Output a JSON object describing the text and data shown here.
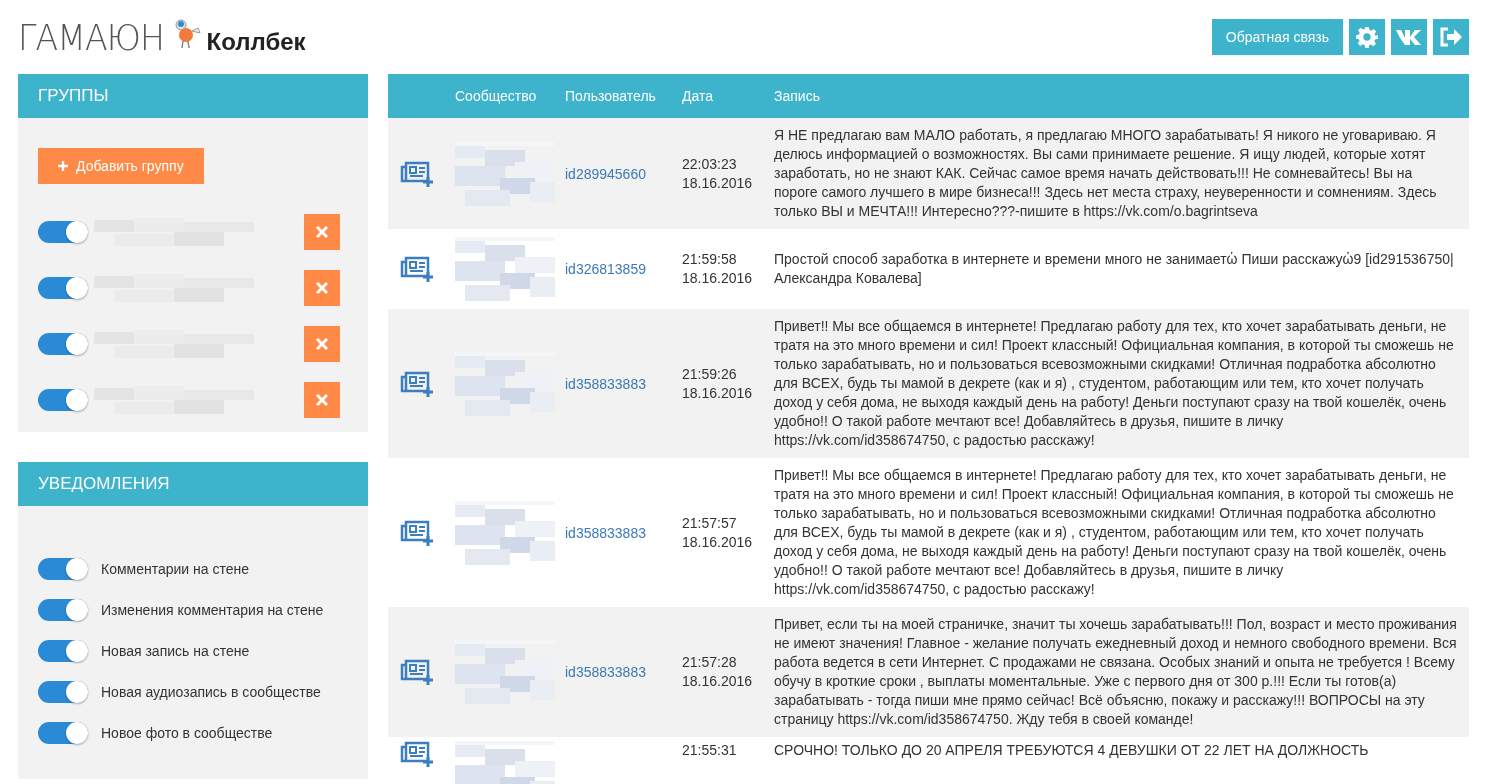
{
  "header": {
    "logo": "ГАМАЮН",
    "subtitle": "Коллбек",
    "feedback_button": "Обратная связь"
  },
  "groups_panel": {
    "title": "ГРУППЫ",
    "add_button": "Добавить группу",
    "groups": [
      {
        "on": true,
        "kind": "picture"
      },
      {
        "on": true,
        "kind": "picture"
      },
      {
        "on": true,
        "kind": "picture"
      },
      {
        "on": true,
        "kind": "picture"
      }
    ]
  },
  "notifications_panel": {
    "title": "УВЕДОМЛЕНИЯ",
    "items": [
      {
        "label": "Комментарии на стене",
        "on": true
      },
      {
        "label": "Изменения комментария на стене",
        "on": true
      },
      {
        "label": "Новая запись на стене",
        "on": true
      },
      {
        "label": "Новая аудиозапись в сообществе",
        "on": true
      },
      {
        "label": "Новое фото в сообществе",
        "on": true
      }
    ]
  },
  "table": {
    "columns": [
      "Сообщество",
      "Пользователь",
      "Дата",
      "Запись"
    ],
    "rows": [
      {
        "user": "id289945660",
        "time": "22:03:23",
        "date": "18.16.2016",
        "text": "Я НЕ предлагаю вам МАЛО работать, я предлагаю МНОГО зарабатывать! Я никого не уговариваю. Я делюсь информацией о возможностях. Вы сами принимаете решение. Я ищу людей, которые хотят заработать, но не знают КАК. Сейчас самое время начать действовать!!! Не сомневайтесь! Вы на пороге самого лучшего в мире бизнеса!!! Здесь нет места страху, неуверенности и сомнениям. Здесь только ВЫ и МЕЧТА!!! Интересно???-пишите в https://vk.com/o.bagrintseva"
      },
      {
        "user": "id326813859",
        "time": "21:59:58",
        "date": "18.16.2016",
        "text": "Простой способ заработка в интернете и времени много не занимаетὡ Пиши расскажуὠ9 [id291536750|Александра Ковалева]"
      },
      {
        "user": "id358833883",
        "time": "21:59:26",
        "date": "18.16.2016",
        "text": "Привет!! Мы все общаемся в интернете! Предлагаю работу для тех, кто хочет зарабатывать деньги, не тратя на это много времени и сил! Проект классный! Официальная компания, в которой ты сможешь не только зарабатывать, но и пользоваться всевозможными скидками! Отличная подработка абсолютно для ВСЕХ, будь ты мамой в декрете (как и я) , студентом, работающим или тем, кто хочет получать доход у себя дома, не выходя каждый день на работу! Деньги поступают сразу на твой кошелёк, очень удобно!! О такой работе мечтают все! Добавляйтесь в друзья, пишите в личку https://vk.com/id358674750, с радостью расскажу!"
      },
      {
        "user": "id358833883",
        "time": "21:57:57",
        "date": "18.16.2016",
        "text": "Привет!! Мы все общаемся в интернете! Предлагаю работу для тех, кто хочет зарабатывать деньги, не тратя на это много времени и сил! Проект классный! Официальная компания, в которой ты сможешь не только зарабатывать, но и пользоваться всевозможными скидками! Отличная подработка абсолютно для ВСЕХ, будь ты мамой в декрете (как и я) , студентом, работающим или тем, кто хочет получать доход у себя дома, не выходя каждый день на работу! Деньги поступают сразу на твой кошелёк, очень удобно!! О такой работе мечтают все! Добавляйтесь в друзья, пишите в личку https://vk.com/id358674750, с радостью расскажу!"
      },
      {
        "user": "id358833883",
        "time": "21:57:28",
        "date": "18.16.2016",
        "text": "Привет, если ты на моей страничке, значит ты хочешь зарабатывать!!! Пол, возраст и место проживания не имеют значения! Главное - желание получать ежедневный доход и немного свободного времени. Вся работа ведется в сети Интернет. С продажами не связана. Особых знаний и опыта не требуется ! Всему обучу в кроткие сроки , выплаты моментальные. Уже с первого дня от 300 р.!!! Если ты готов(а) зарабатывать - тогда пиши мне прямо сейчас! Всё объясню, покажу и расскажу!!! ВОПРОСЫ на эту страницу https://vk.com/id358674750. Жду тебя в своей команде!"
      },
      {
        "time": "21:55:31",
        "text": "СРОЧНО! ТОЛЬКО ДО 20 АПРЕЛЯ ТРЕБУЮТСЯ 4 ДЕВУШКИ ОТ 22 ЛЕТ НА ДОЛЖНОСТЬ"
      }
    ]
  }
}
